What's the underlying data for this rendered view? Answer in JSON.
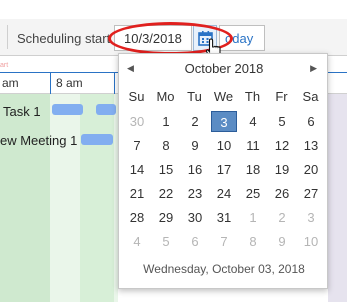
{
  "toolbar": {
    "scheduling_start_label": "Scheduling start",
    "date_value": "10/3/2018",
    "calendar_icon": "calendar-icon",
    "today_label": "oday"
  },
  "timeline": {
    "red_marker_text": "art",
    "columns": [
      "am",
      "8 am"
    ]
  },
  "tasks": [
    {
      "label": "Task 1"
    },
    {
      "label": "ew Meeting 1"
    }
  ],
  "datepicker": {
    "month_title": "October 2018",
    "prev_icon": "caret-left-icon",
    "next_icon": "caret-right-icon",
    "weekdays": [
      "Su",
      "Mo",
      "Tu",
      "We",
      "Th",
      "Fr",
      "Sa"
    ],
    "weeks": [
      [
        {
          "d": "30",
          "o": true
        },
        {
          "d": "1"
        },
        {
          "d": "2"
        },
        {
          "d": "3",
          "sel": true
        },
        {
          "d": "4"
        },
        {
          "d": "5"
        },
        {
          "d": "6"
        }
      ],
      [
        {
          "d": "7"
        },
        {
          "d": "8"
        },
        {
          "d": "9"
        },
        {
          "d": "10"
        },
        {
          "d": "11"
        },
        {
          "d": "12"
        },
        {
          "d": "13"
        }
      ],
      [
        {
          "d": "14"
        },
        {
          "d": "15"
        },
        {
          "d": "16"
        },
        {
          "d": "17"
        },
        {
          "d": "18"
        },
        {
          "d": "19"
        },
        {
          "d": "20"
        }
      ],
      [
        {
          "d": "21"
        },
        {
          "d": "22"
        },
        {
          "d": "23"
        },
        {
          "d": "24"
        },
        {
          "d": "25"
        },
        {
          "d": "26"
        },
        {
          "d": "27"
        }
      ],
      [
        {
          "d": "28"
        },
        {
          "d": "29"
        },
        {
          "d": "30"
        },
        {
          "d": "31"
        },
        {
          "d": "1",
          "o": true
        },
        {
          "d": "2",
          "o": true
        },
        {
          "d": "3",
          "o": true
        }
      ],
      [
        {
          "d": "4",
          "o": true
        },
        {
          "d": "5",
          "o": true
        },
        {
          "d": "6",
          "o": true
        },
        {
          "d": "7",
          "o": true
        },
        {
          "d": "8",
          "o": true
        },
        {
          "d": "9",
          "o": true
        },
        {
          "d": "10",
          "o": true
        }
      ]
    ],
    "footer": "Wednesday, October 03, 2018"
  },
  "colors": {
    "accent": "#2a73c5",
    "selected_day": "#5b8cc4",
    "annotation": "#e0201e",
    "task_bar": "#82aef0"
  }
}
